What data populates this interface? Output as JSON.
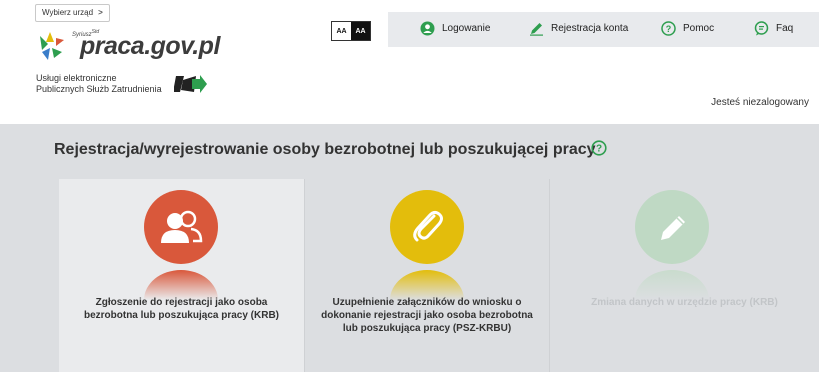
{
  "header": {
    "office_button": "Wybierz urząd",
    "office_chevron": ">",
    "logo": {
      "small_text": "Syriusz",
      "small_suffix": "Std",
      "brand": "praca.gov.pl"
    },
    "tagline_line1": "Usługi elektroniczne",
    "tagline_line2": "Publicznych Służb Zatrudnienia",
    "font_size_normal": "AA",
    "font_size_large": "AA",
    "nav": [
      {
        "label": "Logowanie",
        "icon": "user-icon"
      },
      {
        "label": "Rejestracja konta",
        "icon": "pencil-icon"
      },
      {
        "label": "Pomoc",
        "icon": "help-icon"
      },
      {
        "label": "Faq",
        "icon": "chat-icon"
      }
    ],
    "login_status": "Jesteś niezalogowany"
  },
  "main": {
    "title": "Rejestracja/wyrejestrowanie osoby bezrobotnej lub poszukującej pracy",
    "cards": [
      {
        "label": "Zgłoszenie do rejestracji jako osoba bezrobotna lub poszukująca pracy (KRB)",
        "icon": "users-icon",
        "color": "#d9583b",
        "enabled": true
      },
      {
        "label": "Uzupełnienie załączników do wniosku o dokonanie rejestracji jako osoba bezrobotna lub poszukująca pracy (PSZ-KRBU)",
        "icon": "paperclip-icon",
        "color": "#e3bd0c",
        "enabled": true
      },
      {
        "label": "Zmiana danych w urzędzie pracy (KRB)",
        "icon": "pencil-icon",
        "color": "#bfd9c4",
        "enabled": false
      }
    ]
  },
  "colors": {
    "accent_green": "#2e9e4f",
    "main_bg": "#dcdee1",
    "nav_bg": "#e8eaed"
  }
}
